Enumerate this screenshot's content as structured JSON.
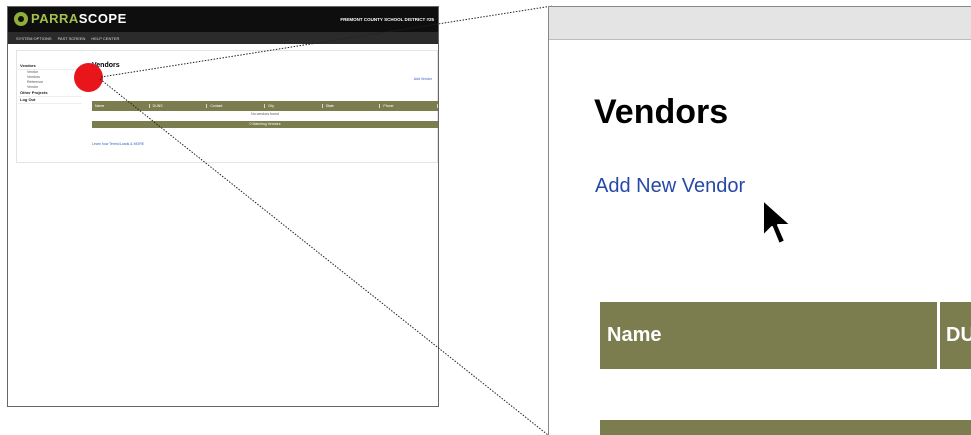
{
  "thumbnail": {
    "logo_prefix": "PARRA",
    "logo_suffix": "SCOPE",
    "district": "FREMONT COUNTY SCHOOL DISTRICT #25",
    "nav_items": [
      "SYSTEM OPTIONS",
      "PAST SCREEN",
      "HELP CENTER"
    ],
    "sidebar": [
      {
        "label": "Vendors",
        "sub": [
          "Vendor",
          "Vendors",
          "Reference",
          "Vendor"
        ]
      },
      {
        "label": "Other Projects",
        "sub": []
      },
      {
        "label": "Log Out",
        "sub": []
      }
    ],
    "page_title": "Vendors",
    "add_link": "Add Vendor",
    "table_headers": [
      "Name",
      "DUNS",
      "Contact",
      "City",
      "State",
      "Phone"
    ],
    "empty_row": "No vendors found",
    "bar_text": "0 Matching Vendors",
    "footer_link": "Learn how Terms/Loads & MORE"
  },
  "zoom": {
    "title": "Vendors",
    "add_link": "Add New Vendor",
    "col_name": "Name",
    "col_du": "DU"
  },
  "colors": {
    "table_header": "#7c7d4e",
    "highlight": "#e8151b",
    "link": "#2648a8",
    "topbar": "#0e0e0e"
  }
}
